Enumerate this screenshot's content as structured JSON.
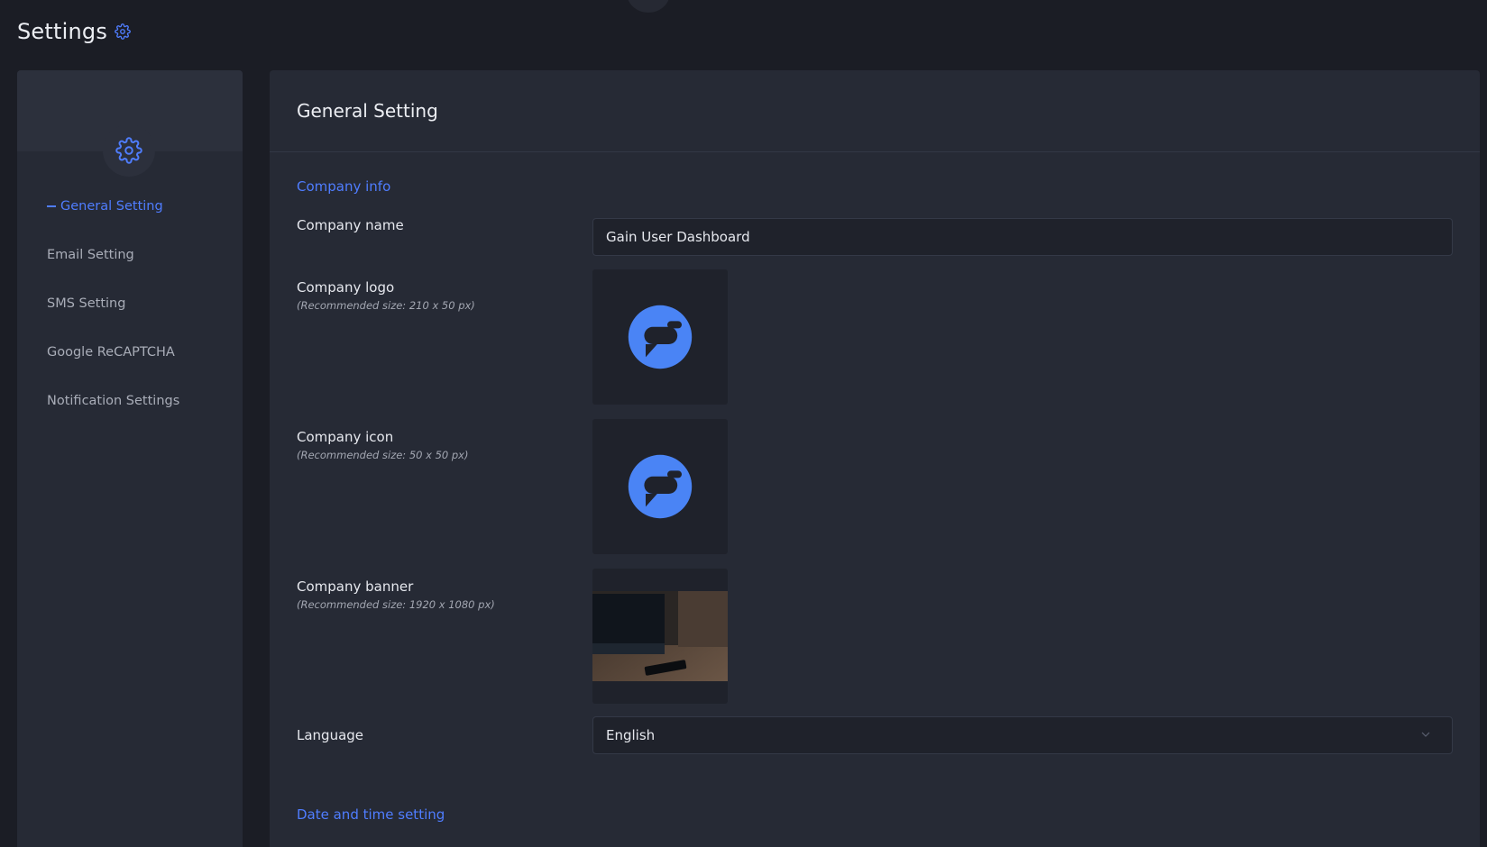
{
  "page": {
    "title": "Settings"
  },
  "sidebar": {
    "items": [
      {
        "label": "General Setting",
        "active": true
      },
      {
        "label": "Email Setting",
        "active": false
      },
      {
        "label": "SMS Setting",
        "active": false
      },
      {
        "label": "Google ReCAPTCHA",
        "active": false
      },
      {
        "label": "Notification Settings",
        "active": false
      }
    ]
  },
  "main": {
    "title": "General Setting",
    "company_info": {
      "section_label": "Company info",
      "name": {
        "label": "Company name",
        "value": "Gain User Dashboard"
      },
      "logo": {
        "label": "Company logo",
        "hint": "(Recommended size: 210 x 50 px)"
      },
      "icon": {
        "label": "Company icon",
        "hint": "(Recommended size: 50 x 50 px)"
      },
      "banner": {
        "label": "Company banner",
        "hint": "(Recommended size: 1920 x 1080 px)"
      },
      "language": {
        "label": "Language",
        "value": "English"
      }
    },
    "date_time": {
      "section_label": "Date and time setting"
    }
  },
  "colors": {
    "accent": "#4f7dff",
    "brand_logo": "#4a84f5",
    "background": "#1b1d25",
    "panel": "#262a35"
  }
}
